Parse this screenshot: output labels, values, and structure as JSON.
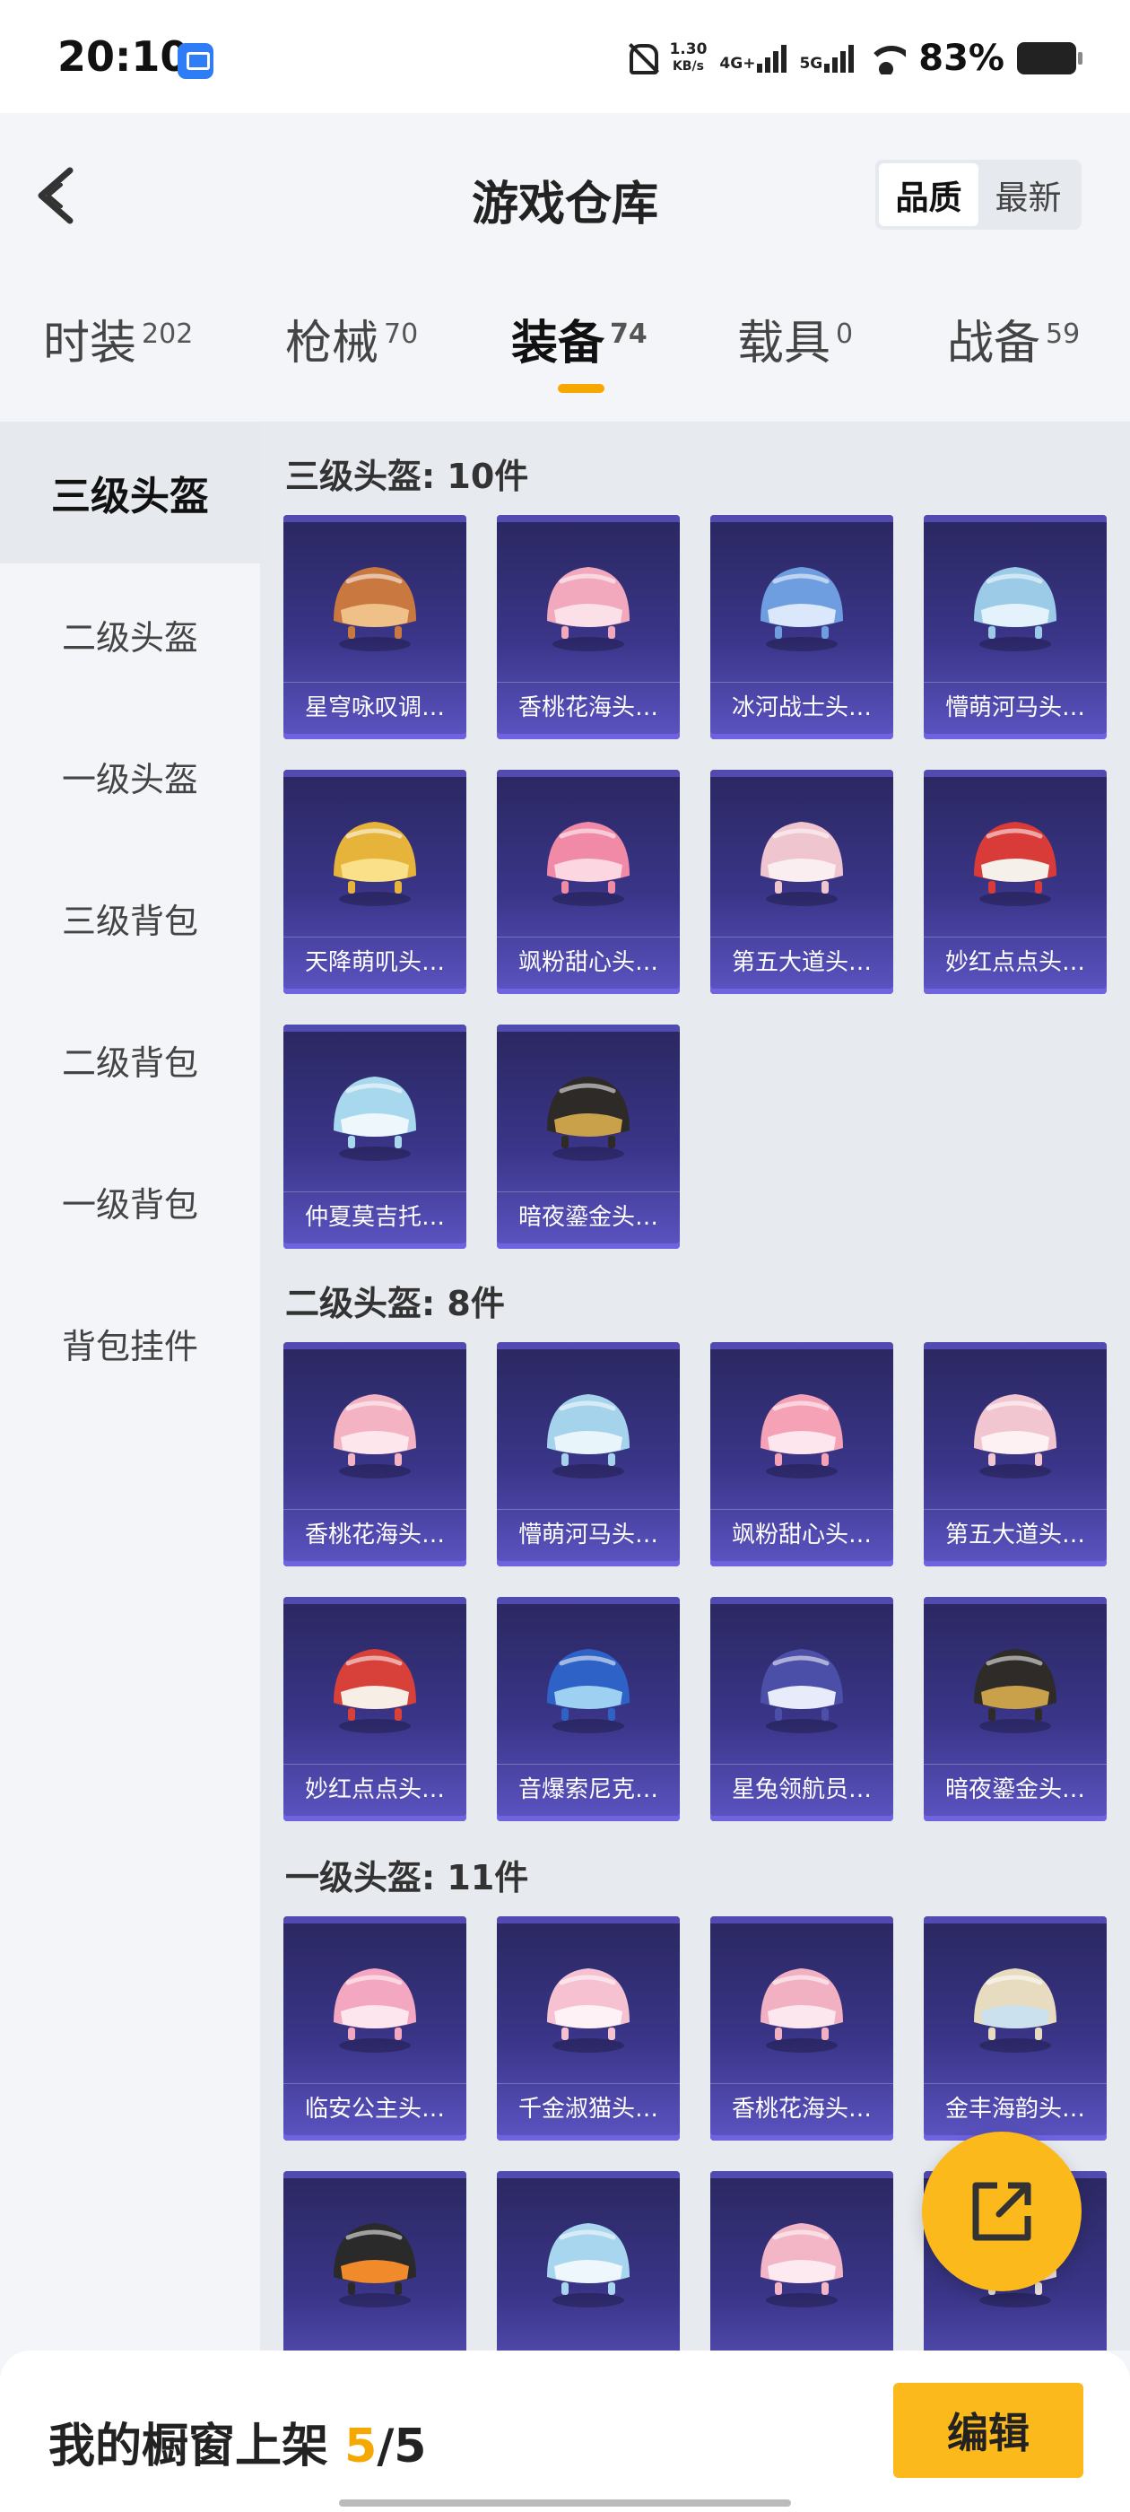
{
  "status_bar": {
    "time": "20:10",
    "speed_value": "1.30",
    "speed_unit": "KB/s",
    "net1": "4G+",
    "net2": "5G",
    "battery": "83%"
  },
  "header": {
    "title": "游戏仓库",
    "sort_options": [
      "品质",
      "最新"
    ]
  },
  "tabs": [
    {
      "label": "时装",
      "count": "202"
    },
    {
      "label": "枪械",
      "count": "70"
    },
    {
      "label": "装备",
      "count": "74"
    },
    {
      "label": "载具",
      "count": "0"
    },
    {
      "label": "战备",
      "count": "59"
    }
  ],
  "sidebar": {
    "items": [
      "三级头盔",
      "二级头盔",
      "一级头盔",
      "三级背包",
      "二级背包",
      "一级背包",
      "背包挂件"
    ]
  },
  "sections": [
    {
      "title": "三级头盔: 10件",
      "items": [
        "星穹咏叹调…",
        "香桃花海头…",
        "冰河战士头…",
        "懵萌河马头…",
        "天降萌叽头…",
        "飒粉甜心头…",
        "第五大道头…",
        "妙红点点头…",
        "仲夏莫吉托…",
        "暗夜鎏金头…"
      ]
    },
    {
      "title": "二级头盔: 8件",
      "items": [
        "香桃花海头…",
        "懵萌河马头…",
        "飒粉甜心头…",
        "第五大道头…",
        "妙红点点头…",
        "音爆索尼克…",
        "星兔领航员…",
        "暗夜鎏金头…"
      ]
    },
    {
      "title": "一级头盔: 11件",
      "items": [
        "临安公主头…",
        "千金淑猫头…",
        "香桃花海头…",
        "金丰海韵头…",
        "",
        "",
        "",
        ""
      ]
    }
  ],
  "bottom_bar": {
    "showcase_label": "我的橱窗上架",
    "showcase_current": "5",
    "showcase_total": "/5",
    "edit_label": "编辑"
  },
  "colors": {
    "accent": "#fbb91c",
    "card_top": "#2a2760",
    "card_bottom": "#5c54c2"
  }
}
